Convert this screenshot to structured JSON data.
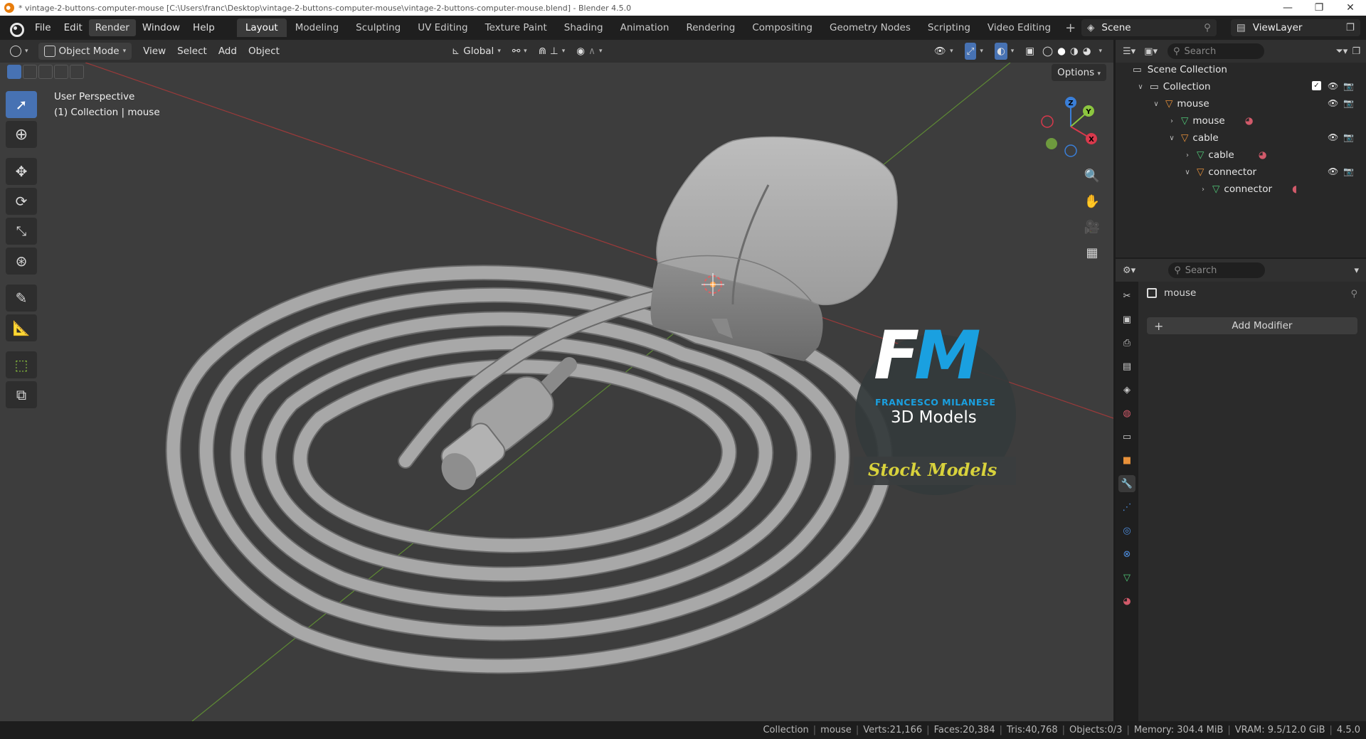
{
  "titlebar": {
    "title": "* vintage-2-buttons-computer-mouse [C:\\Users\\franc\\Desktop\\vintage-2-buttons-computer-mouse\\vintage-2-buttons-computer-mouse.blend] - Blender 4.5.0",
    "minimize": "—",
    "restore": "❐",
    "close": "✕"
  },
  "menu": [
    "File",
    "Edit",
    "Render",
    "Window",
    "Help"
  ],
  "workspaces": [
    "Layout",
    "Modeling",
    "Sculpting",
    "UV Editing",
    "Texture Paint",
    "Shading",
    "Animation",
    "Rendering",
    "Compositing",
    "Geometry Nodes",
    "Scripting",
    "Video Editing"
  ],
  "active_workspace": "Layout",
  "scene": {
    "scene_name": "Scene",
    "view_layer": "ViewLayer"
  },
  "viewport_header": {
    "mode": "Object Mode",
    "view": "View",
    "select": "Select",
    "add": "Add",
    "object": "Object",
    "transform_orientation": "Global"
  },
  "viewport": {
    "perspective_label": "User Perspective",
    "collection_label": "(1) Collection | mouse",
    "options": "Options",
    "gizmo": {
      "z": "Z",
      "y": "Y",
      "x": "X"
    }
  },
  "watermark": {
    "letter_f": "F",
    "letter_m": "M",
    "name": "FRANCESCO MILANESE",
    "sub": "3D Models",
    "banner": "Stock Models"
  },
  "outliner": {
    "search_placeholder": "Search",
    "scene_collection": "Scene Collection",
    "rows": [
      {
        "label": "Collection",
        "depth": 0,
        "type": "collection",
        "expanded": true
      },
      {
        "label": "mouse",
        "depth": 1,
        "type": "object",
        "expanded": true
      },
      {
        "label": "mouse",
        "depth": 2,
        "type": "mesh",
        "expanded": false
      },
      {
        "label": "cable",
        "depth": 2,
        "type": "object",
        "expanded": true
      },
      {
        "label": "cable",
        "depth": 3,
        "type": "mesh",
        "expanded": false
      },
      {
        "label": "connector",
        "depth": 3,
        "type": "object",
        "expanded": true
      },
      {
        "label": "connector",
        "depth": 4,
        "type": "mesh",
        "expanded": false
      }
    ]
  },
  "properties": {
    "search_placeholder": "Search",
    "object_name": "mouse",
    "add_modifier": "Add Modifier"
  },
  "statusbar": {
    "collection": "Collection",
    "object": "mouse",
    "verts": "Verts:21,166",
    "faces": "Faces:20,384",
    "tris": "Tris:40,768",
    "objects": "Objects:0/3",
    "memory": "Memory: 304.4 MiB",
    "vram": "VRAM: 9.5/12.0 GiB",
    "version": "4.5.0"
  },
  "colors": {
    "accent": "#4772b3",
    "x_axis": "#d9394c",
    "y_axis": "#8cc63f",
    "z_axis": "#3a7fd9",
    "object_orange": "#e8913a",
    "mesh_green": "#50c878",
    "watermark_blue": "#1aa0e0",
    "watermark_yellow": "#d8d23c"
  }
}
